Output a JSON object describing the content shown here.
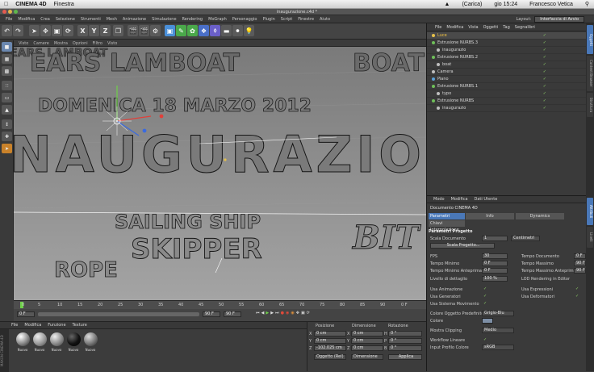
{
  "mac_menu": {
    "app": "CINEMA 4D",
    "items": [
      "Finestra"
    ],
    "status_right": [
      "(Carica)",
      "gio 15:24",
      "Francesco Vetica"
    ]
  },
  "window": {
    "title": "inaugurazione.c4d *"
  },
  "menubar": {
    "items": [
      "File",
      "Modifica",
      "Crea",
      "Selezione",
      "Strumenti",
      "Mesh",
      "Animazione",
      "Simulazione",
      "Rendering",
      "MoGraph",
      "Personaggio",
      "Plugin",
      "Script",
      "Finestre",
      "Aiuto"
    ],
    "layout_label": "Layout:",
    "layout_value": "Interfaccia di Avvio"
  },
  "toolbar": {
    "axis_buttons": [
      "X",
      "Y",
      "Z"
    ]
  },
  "viewport": {
    "menu": [
      "Visto",
      "Camere",
      "Mostra",
      "Opzioni",
      "Filtro",
      "Visto"
    ],
    "label": "Prospettiva",
    "scene_texts": [
      "EARS LAMBOAT",
      "BOAT",
      "DOMENICA 18 MARZO 2012",
      "NAUGURAZIO",
      "SAILING SHIP",
      "SKIPPER",
      "ROPE",
      "BIT"
    ]
  },
  "timeline": {
    "ticks": [
      "0",
      "5",
      "10",
      "15",
      "20",
      "25",
      "30",
      "35",
      "40",
      "45",
      "50",
      "55",
      "60",
      "65",
      "70",
      "75",
      "80",
      "85",
      "90"
    ],
    "current_frame": "0 F",
    "start_field": "0 F",
    "end_field": "90 F",
    "end_field2": "90 F"
  },
  "materials": {
    "menu": [
      "File",
      "Modifica",
      "Funzione",
      "Texture"
    ],
    "names": [
      "Nuovo",
      "Nuovo",
      "Nuovo",
      "Nuovo",
      "Nuovo"
    ],
    "brand": "MAXON CINEMA 4D"
  },
  "coordinates": {
    "headers": [
      "Posizione",
      "Dimensione",
      "Rotazione"
    ],
    "rows": [
      {
        "axis": "X",
        "pos": "0 cm",
        "dim": "0 cm",
        "rot_axis": "H",
        "rot": "0 °"
      },
      {
        "axis": "Y",
        "pos": "0 cm",
        "dim": "0 cm",
        "rot_axis": "P",
        "rot": "0 °"
      },
      {
        "axis": "Z",
        "pos": "-102.025 cm",
        "dim": "0 cm",
        "rot_axis": "B",
        "rot": "0 °"
      }
    ],
    "mode1": "Oggetto (Rel)",
    "mode2": "Dimensione",
    "apply": "Applica"
  },
  "object_manager": {
    "menu": [
      "File",
      "Modifica",
      "Vista",
      "Oggetti",
      "Tag",
      "Segnalibri"
    ],
    "objects": [
      {
        "name": "Luce",
        "color": "#e5c04a",
        "indent": 0,
        "selected": true
      },
      {
        "name": "Estrusione NURBS.3",
        "color": "#6fbf5a",
        "indent": 0
      },
      {
        "name": "inaugurazio",
        "color": "#bfbfbf",
        "indent": 1
      },
      {
        "name": "Estrusione NURBS.2",
        "color": "#6fbf5a",
        "indent": 0
      },
      {
        "name": "boat",
        "color": "#bfbfbf",
        "indent": 1
      },
      {
        "name": "Camera",
        "color": "#bfbfbf",
        "indent": 0
      },
      {
        "name": "Piano",
        "color": "#5aa0d8",
        "indent": 0
      },
      {
        "name": "Estrusione NURBS.1",
        "color": "#6fbf5a",
        "indent": 0
      },
      {
        "name": "typo",
        "color": "#bfbfbf",
        "indent": 1
      },
      {
        "name": "Estrusione NURBS",
        "color": "#6fbf5a",
        "indent": 0
      },
      {
        "name": "inaugurazio",
        "color": "#bfbfbf",
        "indent": 1
      }
    ]
  },
  "attributes": {
    "menu": [
      "Modo",
      "Modifica",
      "Dati Utente"
    ],
    "doc_title": "Documento CINEMA 4D",
    "tabs": [
      "Parametri Progetto",
      "Info",
      "Dynamics"
    ],
    "subtab": "Chiavi Interpolazione",
    "section": "Parametri Progetto",
    "scala_label": "Scala Documento",
    "scala_value": "1",
    "scala_unit": "Centimetri",
    "scala_button": "Scala Progetto...",
    "fields_left": [
      {
        "label": "FPS",
        "value": "30"
      },
      {
        "label": "Tempo Minimo",
        "value": "0 F"
      },
      {
        "label": "Tempo Minimo Anteprima",
        "value": "0 F"
      },
      {
        "label": "Livello di dettaglio",
        "value": "100 %"
      }
    ],
    "fields_right": [
      {
        "label": "Tempo Documento",
        "value": "0 F"
      },
      {
        "label": "Tempo Massimo",
        "value": "90 F"
      },
      {
        "label": "Tempo Massimo Anteprima",
        "value": "90 F"
      },
      {
        "label": "LOD Rendering in Editor",
        "value": ""
      }
    ],
    "checks_left": [
      "Usa Animazione",
      "Usa Generatori",
      "Usa Sistema Movimento"
    ],
    "checks_right": [
      "Usa Espressioni",
      "Usa Deformatori"
    ],
    "colore_default_label": "Colore Oggetto Predefinito",
    "colore_default_value": "Grigio-Blu",
    "colore_label": "Colore",
    "clipping_label": "Mostra Clipping",
    "clipping_value": "Medio",
    "workflow_label": "Workflow Lineare",
    "profile_label": "Input Profilo Colore",
    "profile_value": "sRGB"
  },
  "side_tabs": [
    "Oggetti",
    "Content Browser",
    "Struttura",
    "Attributi",
    "Livelli"
  ]
}
